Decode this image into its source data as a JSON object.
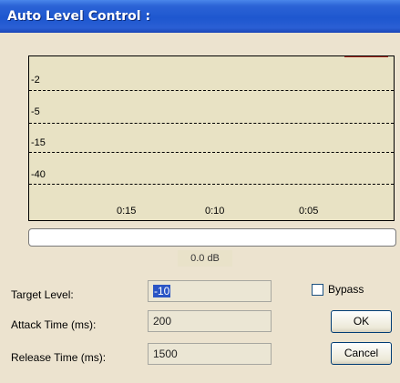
{
  "window": {
    "title": "Auto Level Control :"
  },
  "graph": {
    "y_labels": [
      "-2",
      "-5",
      "-15",
      "-40"
    ],
    "x_labels": [
      "0:15",
      "0:10",
      "0:05"
    ]
  },
  "meter": {
    "value_text": "0.0 dB"
  },
  "form": {
    "target_label": "Target Level:",
    "target_value": "-10",
    "attack_label": "Attack Time (ms):",
    "attack_value": "200",
    "release_label": "Release Time (ms):",
    "release_value": "1500"
  },
  "options": {
    "bypass_label": "Bypass",
    "bypass_checked": false
  },
  "buttons": {
    "ok_label": "OK",
    "cancel_label": "Cancel"
  },
  "colors": {
    "title_bar": "#2b63d6",
    "background": "#ece3cf",
    "graph_background": "#e8e2c4",
    "peak_marker": "#b43225",
    "selection": "#2b55c5"
  }
}
